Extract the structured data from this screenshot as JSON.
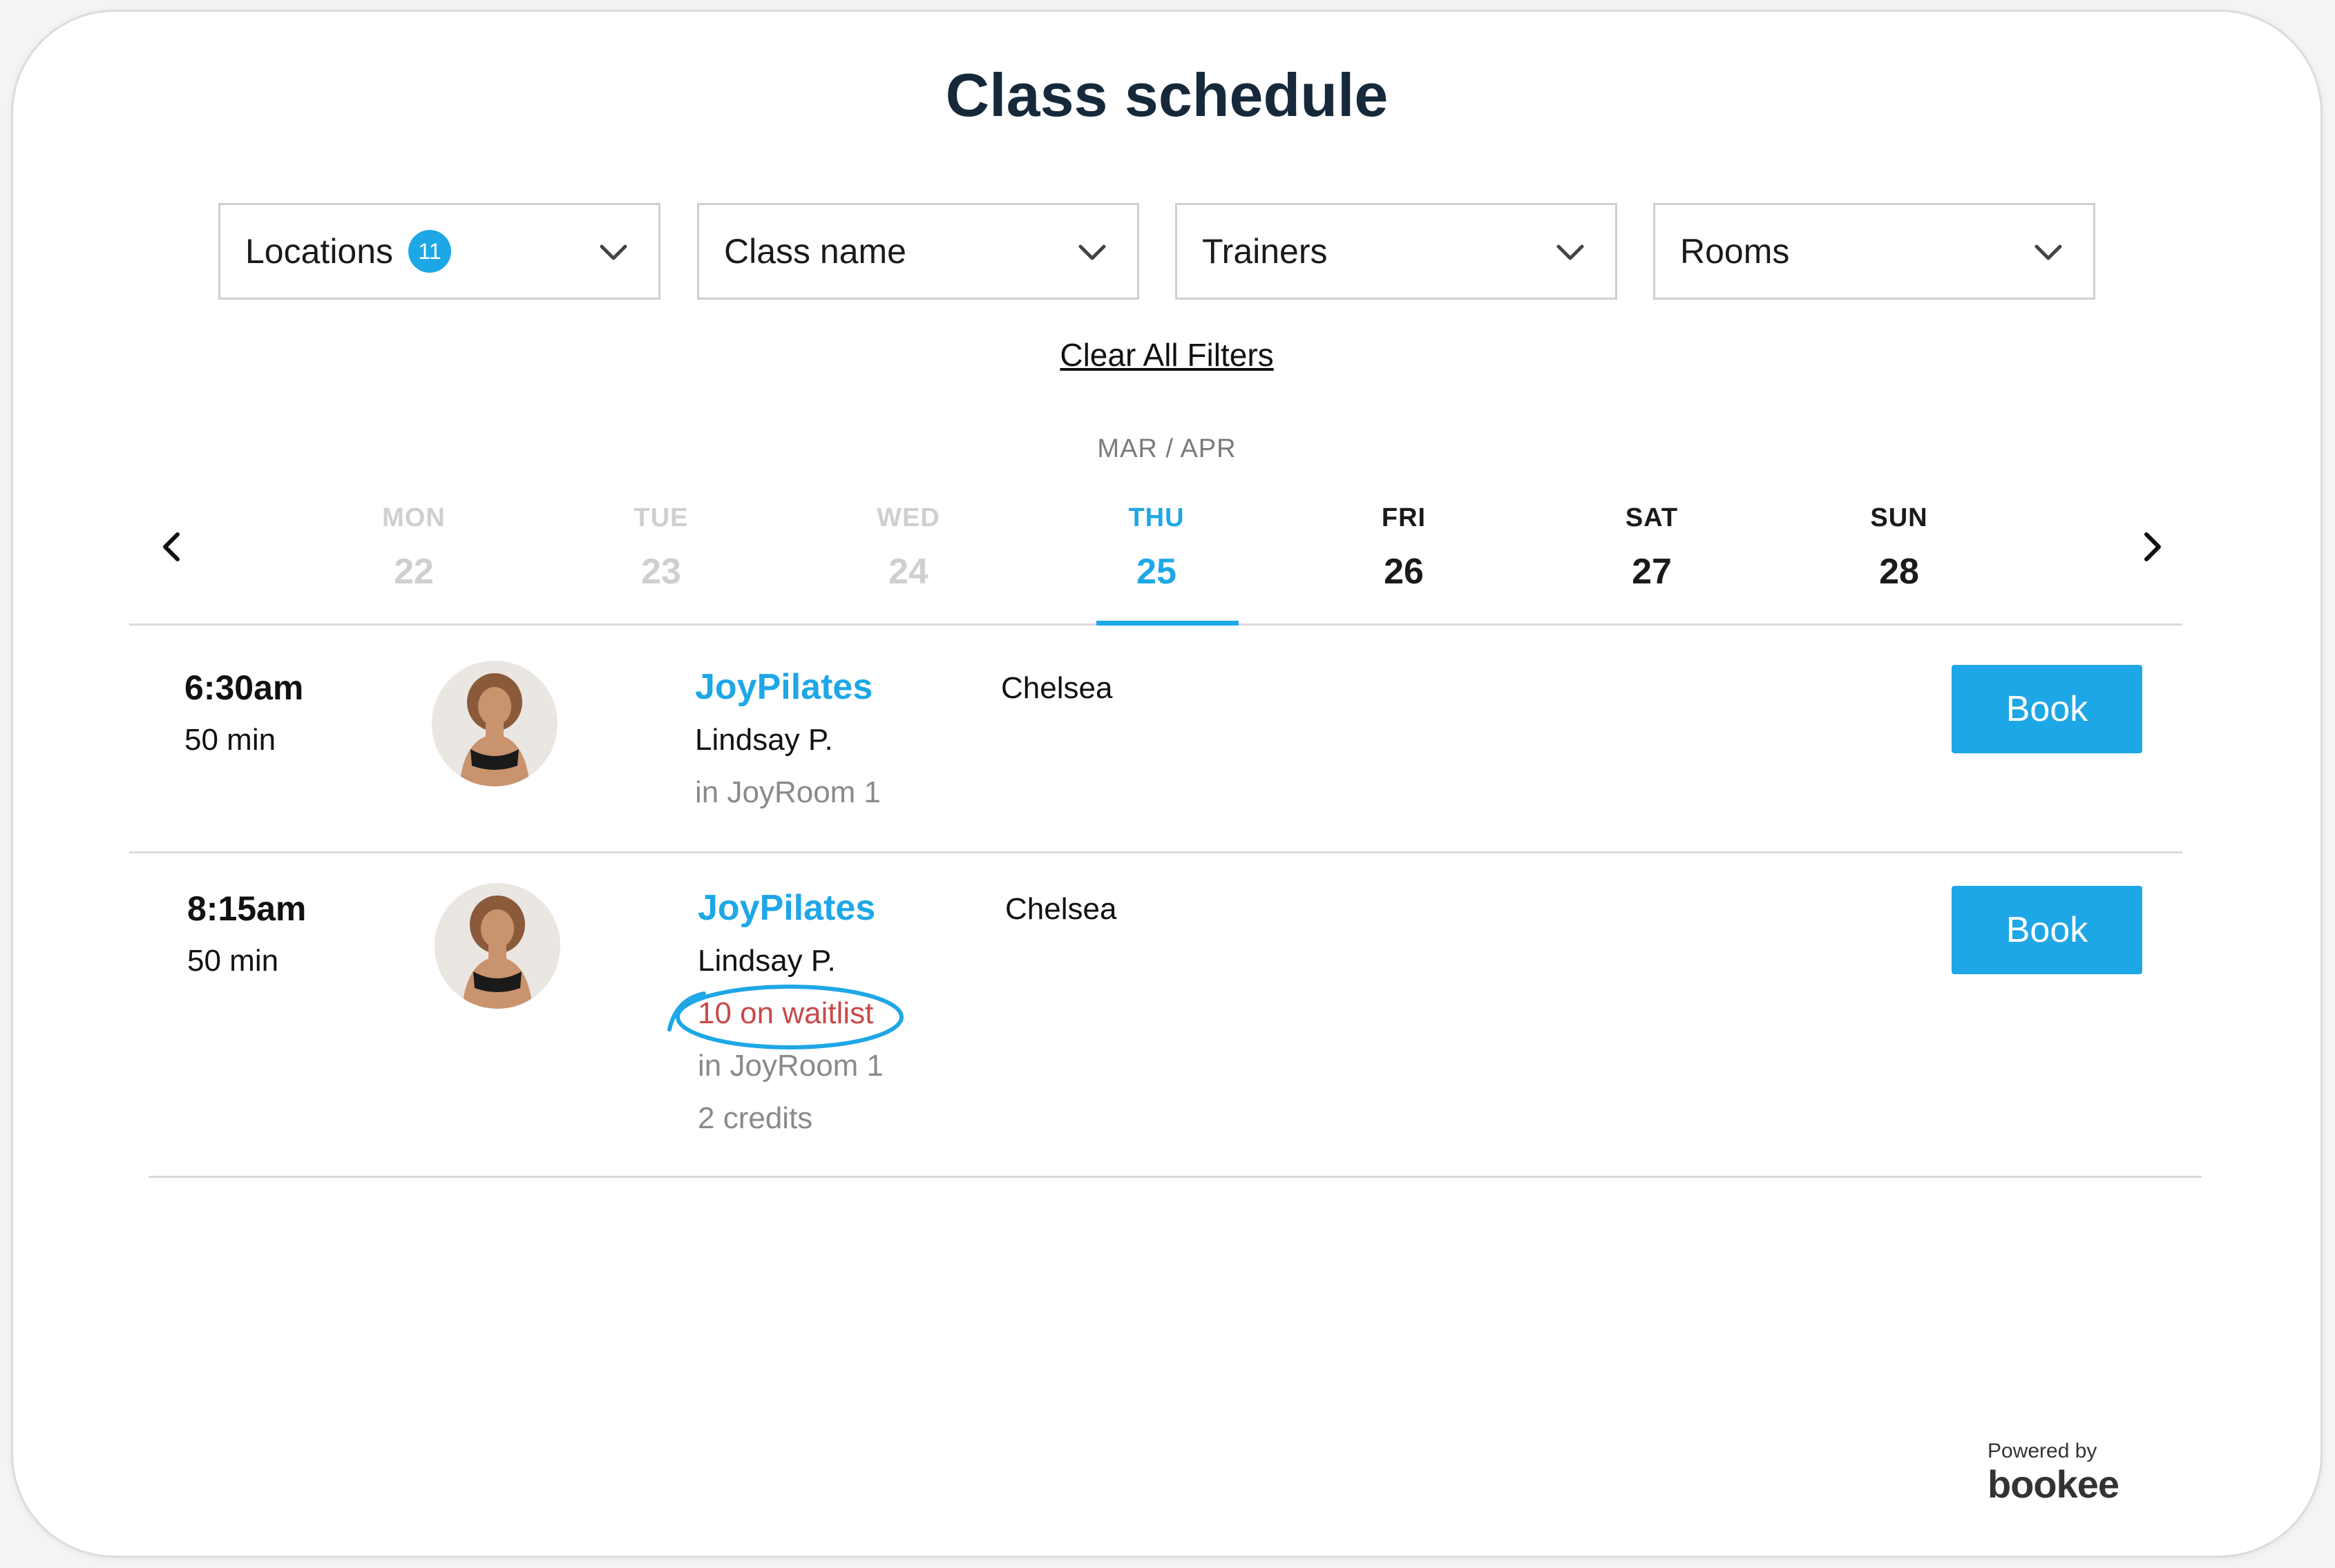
{
  "page": {
    "title": "Class schedule"
  },
  "filters": [
    {
      "label": "Locations",
      "badge": "11"
    },
    {
      "label": "Class name"
    },
    {
      "label": "Trainers"
    },
    {
      "label": "Rooms"
    }
  ],
  "clear_filters": "Clear All Filters",
  "calendar": {
    "month": "MAR / APR",
    "days": [
      {
        "name": "MON",
        "date": "22",
        "state": "past"
      },
      {
        "name": "TUE",
        "date": "23",
        "state": "past"
      },
      {
        "name": "WED",
        "date": "24",
        "state": "past"
      },
      {
        "name": "THU",
        "date": "25",
        "state": "active"
      },
      {
        "name": "FRI",
        "date": "26",
        "state": "future"
      },
      {
        "name": "SAT",
        "date": "27",
        "state": "future"
      },
      {
        "name": "SUN",
        "date": "28",
        "state": "future"
      }
    ]
  },
  "classes": [
    {
      "time": "6:30am",
      "duration": "50 min",
      "name": "JoyPilates",
      "trainer": "Lindsay P.",
      "room": "in JoyRoom 1",
      "location": "Chelsea",
      "book_label": "Book"
    },
    {
      "time": "8:15am",
      "duration": "50 min",
      "name": "JoyPilates",
      "trainer": "Lindsay P.",
      "waitlist": "10 on waitlist",
      "room": "in JoyRoom 1",
      "credits": "2 credits",
      "location": "Chelsea",
      "book_label": "Book"
    }
  ],
  "footer": {
    "powered_by": "Powered by",
    "brand": "bookee"
  },
  "colors": {
    "accent": "#1ea7e6",
    "waitlist": "#c84a4a",
    "title": "#16293b"
  }
}
